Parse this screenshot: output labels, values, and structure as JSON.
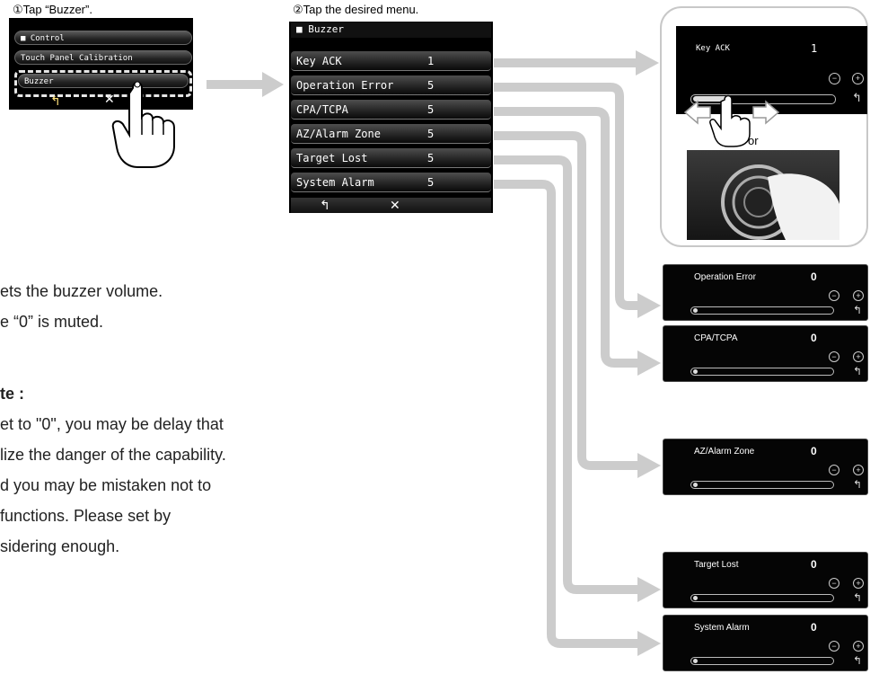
{
  "step1": {
    "caption": "①Tap “Buzzer”.",
    "items": [
      "Control",
      "Touch Panel Calibration",
      "Buzzer"
    ],
    "footer_back": "↰",
    "footer_close": "✕"
  },
  "step2": {
    "caption": "②Tap the desired menu.",
    "header": "Buzzer",
    "rows": [
      {
        "label": "Key ACK",
        "value": "1"
      },
      {
        "label": "Operation Error",
        "value": "5"
      },
      {
        "label": "CPA/TCPA",
        "value": "5"
      },
      {
        "label": "AZ/Alarm Zone",
        "value": "5"
      },
      {
        "label": "Target Lost",
        "value": "5"
      },
      {
        "label": "System Alarm",
        "value": "5"
      }
    ],
    "footer_back": "↰",
    "footer_close": "✕"
  },
  "key_ack_panel": {
    "title": "Key ACK",
    "value": "1",
    "or_label": "or",
    "minus": "−",
    "plus": "+",
    "back": "↰"
  },
  "panels": [
    {
      "title": "Operation Error",
      "value": "0"
    },
    {
      "title": "CPA/TCPA",
      "value": "0"
    },
    {
      "title": "AZ/Alarm Zone",
      "value": "0"
    },
    {
      "title": "Target Lost",
      "value": "0"
    },
    {
      "title": "System Alarm",
      "value": "0"
    }
  ],
  "panel_controls": {
    "minus": "−",
    "plus": "+",
    "back": "↰"
  },
  "text": {
    "line1": "ets the buzzer volume.",
    "line2": "e “0” is muted.",
    "note_head": "te :",
    "note1": "et to \"0\", you may be delay that",
    "note2": "lize the danger of the capability.",
    "note3": "d    you may be mistaken not to",
    "note4": " functions. Please set by",
    "note5": "sidering enough."
  },
  "colors": {
    "arrow": "#cccccc",
    "screen_bg": "#000000",
    "box_border": "#c8c8c8"
  }
}
